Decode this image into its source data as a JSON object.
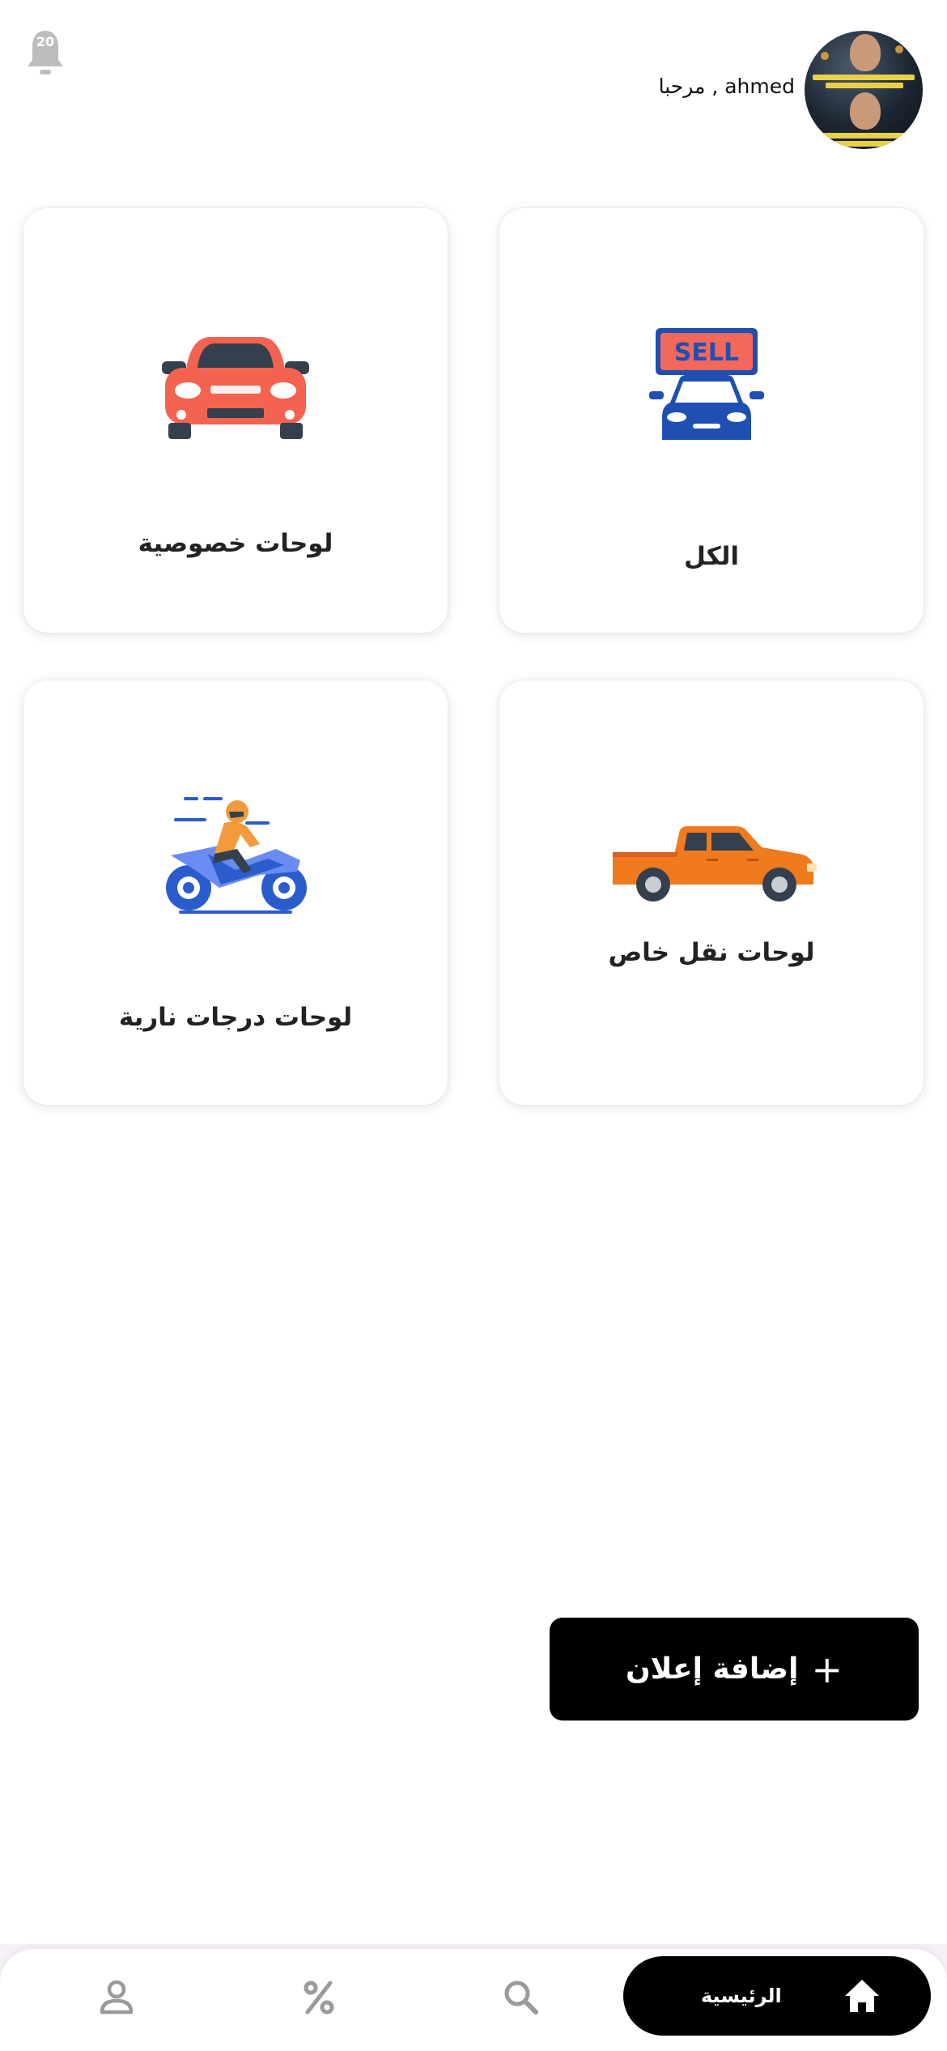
{
  "header": {
    "greeting": "مرحبا , ahmed",
    "notification_count": "20"
  },
  "categories": [
    {
      "label": "الكل",
      "icon": "sell-car-icon"
    },
    {
      "label": "لوحات خصوصية",
      "icon": "private-car-icon"
    },
    {
      "label": "لوحات نقل خاص",
      "icon": "pickup-truck-icon"
    },
    {
      "label": "لوحات درجات نارية",
      "icon": "motorcycle-icon"
    }
  ],
  "sell_badge": "SELL",
  "add_button": {
    "label": "إضافة إعلان",
    "plus": "+"
  },
  "bottom_nav": {
    "home_label": "الرئيسية",
    "items": [
      "home-icon",
      "search-icon",
      "percent-icon",
      "profile-icon"
    ]
  },
  "colors": {
    "accent": "#000000",
    "card_bg": "#ffffff",
    "sell_blue": "#1f4fb3",
    "sell_sign": "#f3685a",
    "private_car": "#f4634f",
    "pickup": "#f07a1e",
    "motorcycle_blue": "#2a5ccc"
  }
}
